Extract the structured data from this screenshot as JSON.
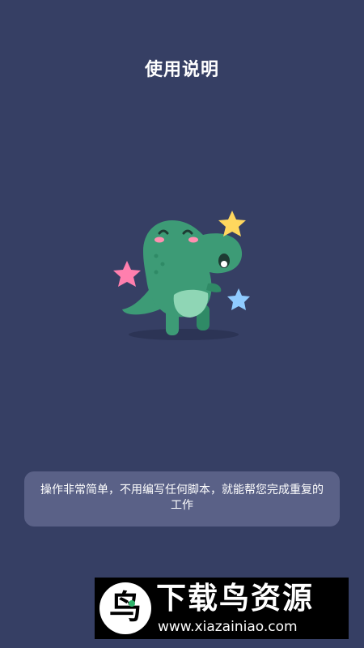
{
  "page": {
    "title": "使用说明",
    "description": "操作非常简单，不用编写任何脚本，就能帮您完成重复的工作"
  },
  "watermark": {
    "logo_glyph": "鸟",
    "name": "下载鸟资源",
    "url": "www.xiazainiao.com"
  },
  "colors": {
    "background": "#363f64",
    "card": "#5a6187",
    "dino": "#3d9b76",
    "dino_light": "#8fd6b5",
    "star_yellow": "#ffd75e",
    "star_pink": "#ff7fae",
    "star_blue": "#8fcbff"
  },
  "icons": {
    "illustration": "dinosaur-mascot",
    "stars": [
      "star-yellow-icon",
      "star-pink-icon",
      "star-blue-icon"
    ]
  }
}
